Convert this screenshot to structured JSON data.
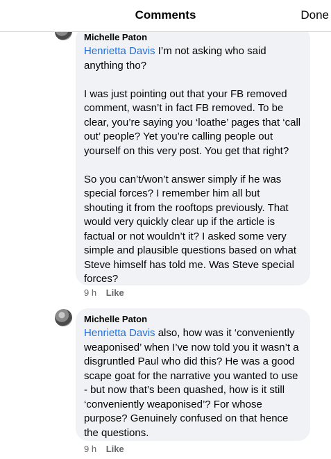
{
  "header": {
    "title": "Comments",
    "done_label": "Done"
  },
  "comments": [
    {
      "author": "Michelle Paton",
      "mention": "Henrietta Davis",
      "text": " I’m not asking who said anything tho?\n\nI was just pointing out that your FB removed comment, wasn’t in fact FB removed. To be clear, you’re saying you ‘loathe’ pages that ‘call out’ people? Yet you’re calling people out yourself on this very post. You get that right?\n\nSo you can’t/won’t answer simply if he was special forces? I remember him all but shouting it from the rooftops previously. That would very quickly clear up if the article is factual or not wouldn’t it? I asked some very simple and plausible questions based on what Steve himself has told me. Was Steve special forces?",
      "time": "9 h",
      "like_label": "Like"
    },
    {
      "author": "Michelle Paton",
      "mention": "Henrietta Davis",
      "text": " also, how was it ‘conveniently weaponised’ when I’ve now told you it wasn’t a disgruntled Paul who did this? He was a good scape goat for the narrative you wanted to use - but now that’s been quashed, how is it still ‘conveniently weaponised’? For whose purpose? Genuinely confused on that hence the questions.",
      "time": "9 h",
      "like_label": "Like"
    }
  ]
}
